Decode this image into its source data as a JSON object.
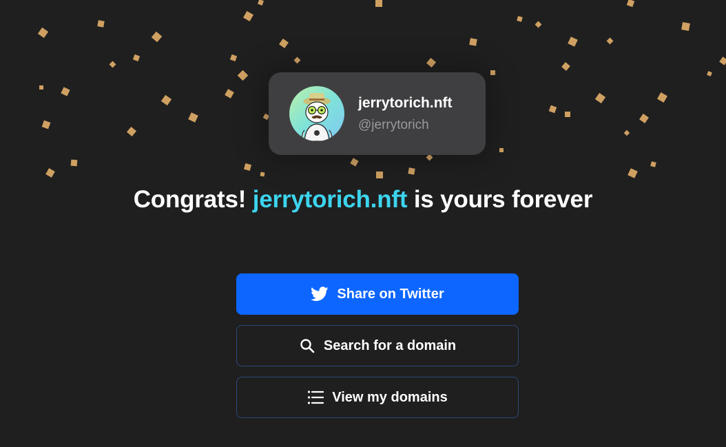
{
  "profile": {
    "name": "jerrytorich.nft",
    "handle": "@jerrytorich",
    "avatar_icon": "cartoon-avatar-icon"
  },
  "headline": {
    "prefix": "Congrats! ",
    "domain": "jerrytorich.nft",
    "suffix": " is yours forever"
  },
  "buttons": {
    "share_twitter": {
      "label": "Share on Twitter",
      "icon": "twitter-bird-icon"
    },
    "search_domain": {
      "label": "Search for a domain",
      "icon": "search-icon"
    },
    "view_domains": {
      "label": "View my domains",
      "icon": "list-icon"
    }
  },
  "colors": {
    "background": "#1f1f1f",
    "accent": "#3cd4ee",
    "primary_button": "#0d66ff",
    "confetti": "#d9a866"
  }
}
